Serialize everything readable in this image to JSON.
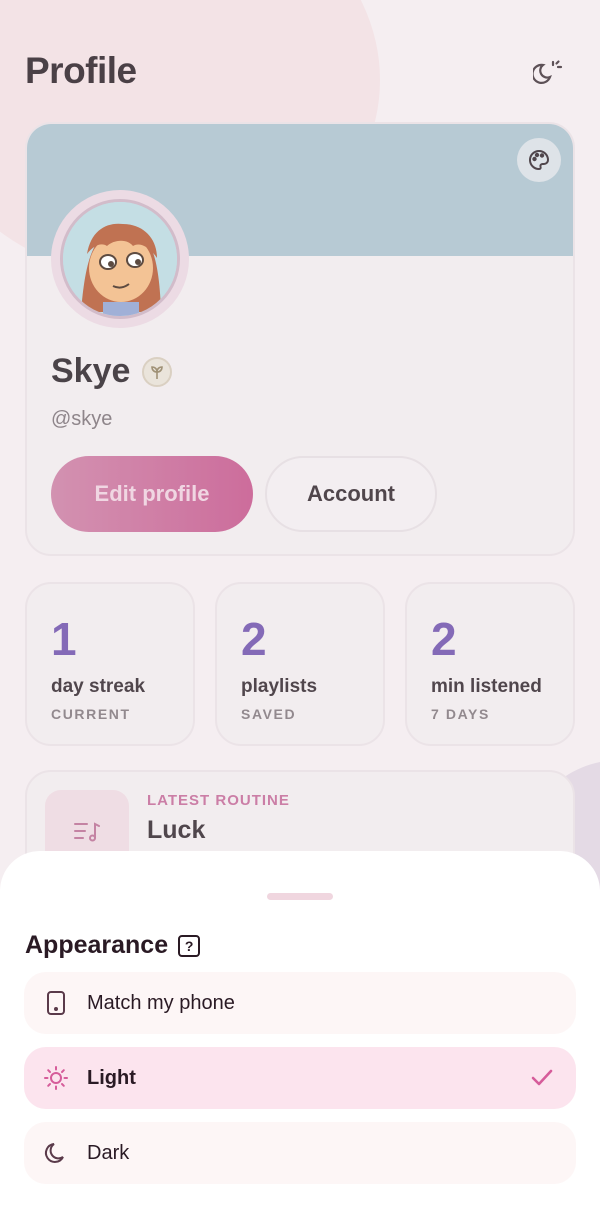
{
  "header": {
    "title": "Profile",
    "theme_icon": "moon-sun-icon"
  },
  "profile": {
    "name": "Skye",
    "handle": "@skye",
    "badge_icon": "plant-badge-icon",
    "palette_icon": "palette-icon",
    "banner_color": "#a8bfcb",
    "edit_label": "Edit profile",
    "account_label": "Account"
  },
  "stats": [
    {
      "value": "1",
      "label": "day streak",
      "sub": "CURRENT"
    },
    {
      "value": "2",
      "label": "playlists",
      "sub": "SAVED"
    },
    {
      "value": "2",
      "label": "min listened",
      "sub": "7 DAYS"
    }
  ],
  "routine": {
    "kicker": "LATEST ROUTINE",
    "title": "Luck",
    "icon": "playlist-icon"
  },
  "appearance_sheet": {
    "title": "Appearance",
    "help_label": "?",
    "options": [
      {
        "label": "Match my phone",
        "icon": "phone-icon",
        "selected": false
      },
      {
        "label": "Light",
        "icon": "sun-icon",
        "selected": true
      },
      {
        "label": "Dark",
        "icon": "moon-icon",
        "selected": false
      }
    ]
  },
  "colors": {
    "accent": "#c24d86",
    "stat_number": "#6a4aa8",
    "selected_bg": "#fce4ee"
  }
}
